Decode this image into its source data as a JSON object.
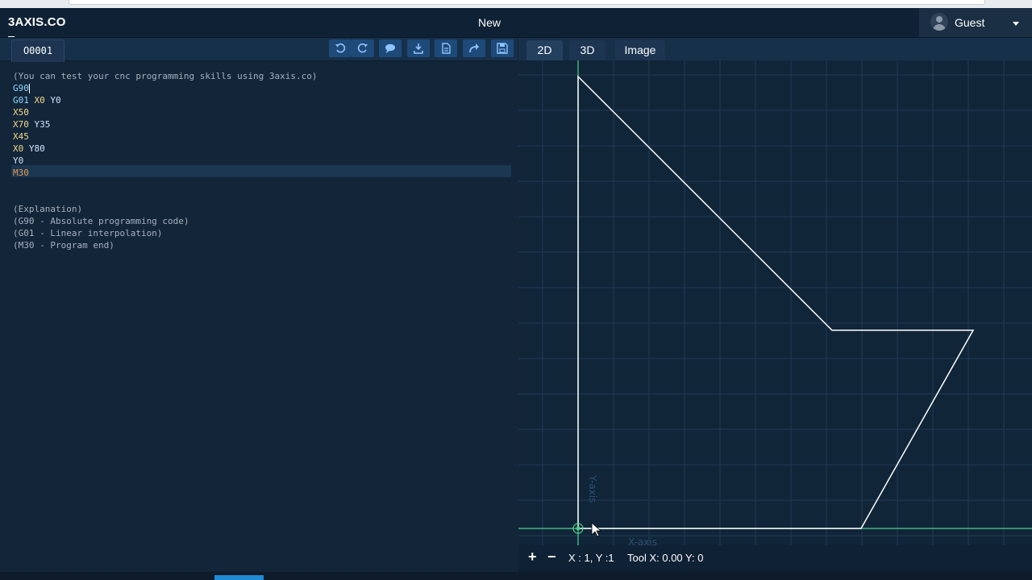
{
  "app": {
    "brand": "3AXIS.CO",
    "title": "New",
    "user": "Guest"
  },
  "editor": {
    "file_tab": "O0001",
    "toolbar_icons": [
      "undo-icon",
      "redo-icon",
      "comment-icon",
      "download-icon",
      "file-icon",
      "share-icon",
      "save-icon"
    ],
    "lines": [
      {
        "text": "(You can test your cnc programming skills using 3axis.co)"
      },
      {
        "text": "G90"
      },
      {
        "g": "G01",
        "a": "X0",
        "b": "Y0"
      },
      {
        "text": "X50"
      },
      {
        "a": "X70",
        "b": "Y35"
      },
      {
        "text": "X45"
      },
      {
        "a": "X0",
        "b": "Y80"
      },
      {
        "text": "Y0"
      },
      {
        "text": "M30"
      },
      {
        "text": ""
      },
      {
        "text": ""
      },
      {
        "text": "(Explanation)"
      },
      {
        "text": "(G90 - Absolute programming code)"
      },
      {
        "text": "(G01 - Linear interpolation)"
      },
      {
        "text": "(M30 - Program end)"
      }
    ]
  },
  "viewer": {
    "tabs": [
      "2D",
      "3D",
      "Image"
    ],
    "active_tab": "2D",
    "axis_labels": {
      "y": "Y-axis",
      "x": "X-axis"
    },
    "status": {
      "zoom_in": "+",
      "zoom_out": "−",
      "coords": "X : 1, Y :1",
      "tool": "Tool X: 0.00 Y: 0"
    },
    "colors": {
      "path": "#ffffff",
      "axis": "#4fd08a",
      "grid": "#1e3a55"
    }
  }
}
